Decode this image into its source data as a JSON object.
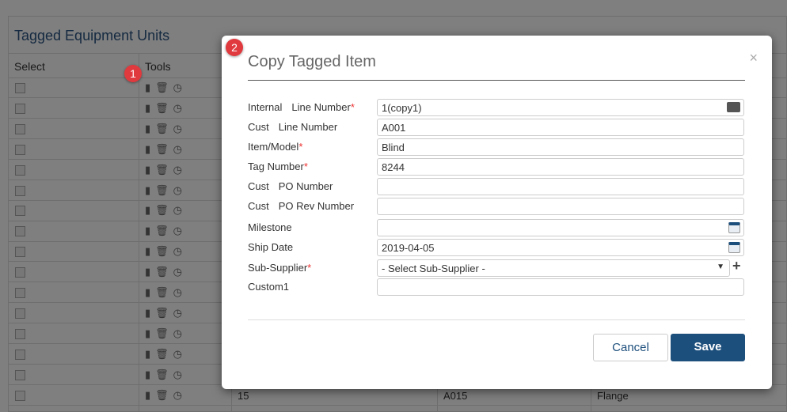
{
  "panel": {
    "title": "Tagged Equipment Units",
    "columns": [
      "Select",
      "Tools"
    ]
  },
  "last_row": {
    "line": "15",
    "cust_line": "A015",
    "item": "Flange"
  },
  "badges": [
    "1",
    "2"
  ],
  "modal": {
    "title": "Copy Tagged Item",
    "close": "×",
    "fields": [
      {
        "label_a": "Internal",
        "label_b": "Line Number",
        "required": "*",
        "value": "1(copy1)",
        "icon": "contact-card-icon"
      },
      {
        "label_a": "Cust",
        "label_b": "Line Number",
        "required": "",
        "value": "A001"
      },
      {
        "label_a": "Item/Model",
        "label_b": "",
        "required": "*",
        "value": "Blind"
      },
      {
        "label_a": "Tag Number",
        "label_b": "",
        "required": "*",
        "value": "8244"
      },
      {
        "label_a": "Cust",
        "label_b": "PO Number",
        "required": "",
        "value": ""
      },
      {
        "label_a": "Cust",
        "label_b": "PO Rev Number",
        "required": "",
        "value": ""
      },
      {
        "label_a": "Milestone",
        "label_b": "",
        "required": "",
        "value": "",
        "icon": "calendar-icon"
      },
      {
        "label_a": "Ship Date",
        "label_b": "",
        "required": "",
        "value": "2019-04-05",
        "icon": "calendar-icon"
      },
      {
        "label_a": "Sub-Supplier",
        "label_b": "",
        "required": "*",
        "value": "- Select Sub-Supplier -",
        "icon": "dropdown-icon"
      },
      {
        "label_a": "Custom1",
        "label_b": "",
        "required": "",
        "value": ""
      }
    ],
    "add": "+",
    "cancel": "Cancel",
    "save": "Save",
    "colors": {
      "primary": "#1d4f7c",
      "required": "#e33333",
      "badge": "#e0393e"
    }
  }
}
